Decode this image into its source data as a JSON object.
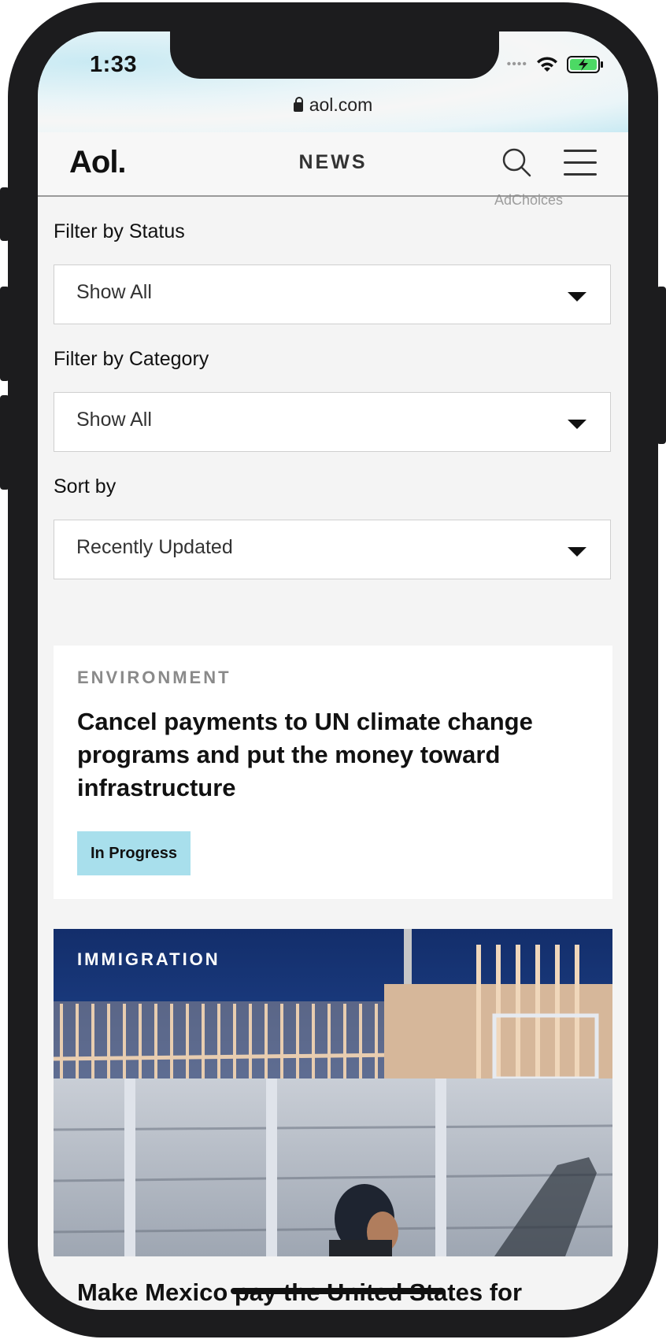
{
  "status_bar": {
    "time": "1:33"
  },
  "browser": {
    "url": "aol.com"
  },
  "header": {
    "logo": "Aol.",
    "section": "NEWS"
  },
  "ad": {
    "label": "AdChoices"
  },
  "filters": [
    {
      "label": "Filter by Status",
      "value": "Show All"
    },
    {
      "label": "Filter by Category",
      "value": "Show All"
    },
    {
      "label": "Sort by",
      "value": "Recently Updated"
    }
  ],
  "cards": [
    {
      "category": "ENVIRONMENT",
      "title": "Cancel payments to UN climate change programs and put the money toward infrastructure",
      "status": "In Progress"
    },
    {
      "category": "IMMIGRATION",
      "title": "Make Mexico pay the United States for"
    }
  ],
  "colors": {
    "badge": "#a8dfec",
    "frame": "#1c1c1e",
    "background": "#f4f4f4"
  }
}
